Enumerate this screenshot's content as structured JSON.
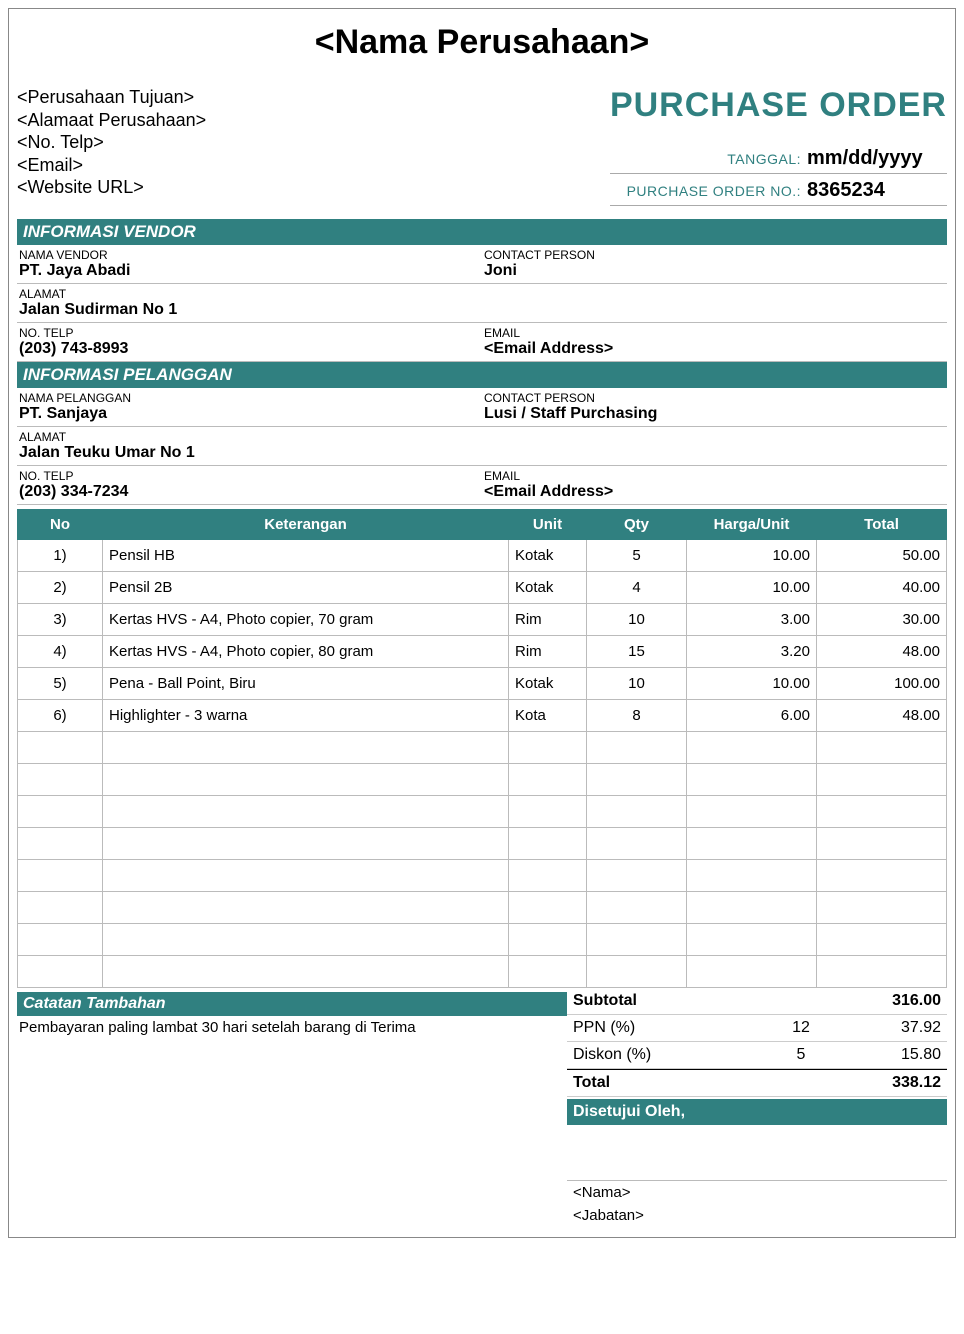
{
  "company_name": "<Nama Perusahaan>",
  "addr": {
    "line1": "<Perusahaan Tujuan>",
    "line2": "<Alamaat Perusahaan>",
    "line3": "<No. Telp>",
    "line4": "<Email>",
    "line5": "<Website URL>"
  },
  "po_title": "PURCHASE ORDER",
  "meta": {
    "date_label": "TANGGAL:",
    "date_value": "mm/dd/yyyy",
    "pono_label": "PURCHASE ORDER NO.:",
    "pono_value": "8365234"
  },
  "vendor_section": {
    "title": "INFORMASI VENDOR",
    "name_label": "NAMA VENDOR",
    "name_value": "PT. Jaya Abadi",
    "contact_label": "CONTACT PERSON",
    "contact_value": "Joni",
    "addr_label": "ALAMAT",
    "addr_value": "Jalan Sudirman No 1",
    "tel_label": "NO. TELP",
    "tel_value": "(203) 743-8993",
    "email_label": "EMAIL",
    "email_value": "<Email Address>"
  },
  "cust_section": {
    "title": "INFORMASI PELANGGAN",
    "name_label": "NAMA PELANGGAN",
    "name_value": "PT. Sanjaya",
    "contact_label": "CONTACT PERSON",
    "contact_value": "Lusi / Staff Purchasing",
    "addr_label": "ALAMAT",
    "addr_value": "Jalan Teuku Umar No 1",
    "tel_label": "NO. TELP",
    "tel_value": "(203) 334-7234",
    "email_label": "EMAIL",
    "email_value": "<Email Address>"
  },
  "table": {
    "headers": {
      "no": "No",
      "desc": "Keterangan",
      "unit": "Unit",
      "qty": "Qty",
      "price": "Harga/Unit",
      "total": "Total"
    },
    "rows": [
      {
        "no": "1)",
        "desc": "Pensil HB",
        "unit": "Kotak",
        "qty": "5",
        "price": "10.00",
        "total": "50.00"
      },
      {
        "no": "2)",
        "desc": "Pensil 2B",
        "unit": "Kotak",
        "qty": "4",
        "price": "10.00",
        "total": "40.00"
      },
      {
        "no": "3)",
        "desc": "Kertas HVS - A4, Photo copier, 70 gram",
        "unit": "Rim",
        "qty": "10",
        "price": "3.00",
        "total": "30.00"
      },
      {
        "no": "4)",
        "desc": "Kertas HVS - A4, Photo copier, 80 gram",
        "unit": "Rim",
        "qty": "15",
        "price": "3.20",
        "total": "48.00"
      },
      {
        "no": "5)",
        "desc": "Pena - Ball Point, Biru",
        "unit": "Kotak",
        "qty": "10",
        "price": "10.00",
        "total": "100.00"
      },
      {
        "no": "6)",
        "desc": "Highlighter - 3 warna",
        "unit": "Kota",
        "qty": "8",
        "price": "6.00",
        "total": "48.00"
      }
    ],
    "empty_row_count": 8
  },
  "notes": {
    "title": "Catatan Tambahan",
    "text": "Pembayaran paling lambat 30 hari setelah barang di Terima"
  },
  "totals": {
    "subtotal_label": "Subtotal",
    "subtotal_value": "316.00",
    "ppn_label": "PPN (%)",
    "ppn_pct": "12",
    "ppn_value": "37.92",
    "diskon_label": "Diskon (%)",
    "diskon_pct": "5",
    "diskon_value": "15.80",
    "total_label": "Total",
    "total_value": "338.12"
  },
  "approval": {
    "title": "Disetujui Oleh,",
    "name": "<Nama>",
    "role": "<Jabatan>"
  }
}
